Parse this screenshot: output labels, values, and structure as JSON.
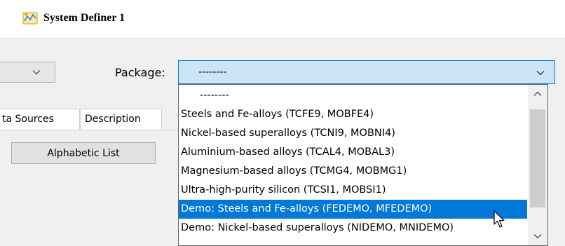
{
  "window": {
    "title": "System Definer 1",
    "icon": "system-definer-icon"
  },
  "left_combo": {
    "icon": "chevron-down-icon"
  },
  "package": {
    "label": "Package:",
    "value": "--------",
    "icon": "chevron-down-icon"
  },
  "tabs": [
    {
      "label": "ta Sources"
    },
    {
      "label": "Description"
    }
  ],
  "buttons": {
    "alphabetic_list": "Alphabetic List"
  },
  "dropdown": {
    "items": [
      {
        "label": "--------",
        "selected": false
      },
      {
        "label": "Steels and Fe-alloys (TCFE9, MOBFE4)",
        "selected": false
      },
      {
        "label": "Nickel-based superalloys (TCNI9, MOBNI4)",
        "selected": false
      },
      {
        "label": "Aluminium-based alloys (TCAL4, MOBAL3)",
        "selected": false
      },
      {
        "label": "Magnesium-based alloys (TCMG4, MOBMG1)",
        "selected": false
      },
      {
        "label": "Ultra-high-purity silicon (TCSI1, MOBSI1)",
        "selected": false
      },
      {
        "label": "Demo: Steels and Fe-alloys (FEDEMO, MFEDEMO)",
        "selected": true
      },
      {
        "label": "Demo: Nickel-based superalloys (NIDEMO, MNIDEMO)",
        "selected": false
      }
    ],
    "scroll_up_icon": "chevron-up-icon",
    "scroll_down_icon": "chevron-down-icon"
  },
  "colors": {
    "selection": "#0078d7",
    "combo_focus_bg": "#cce4f7",
    "panel_bg": "#f0f0f0"
  }
}
